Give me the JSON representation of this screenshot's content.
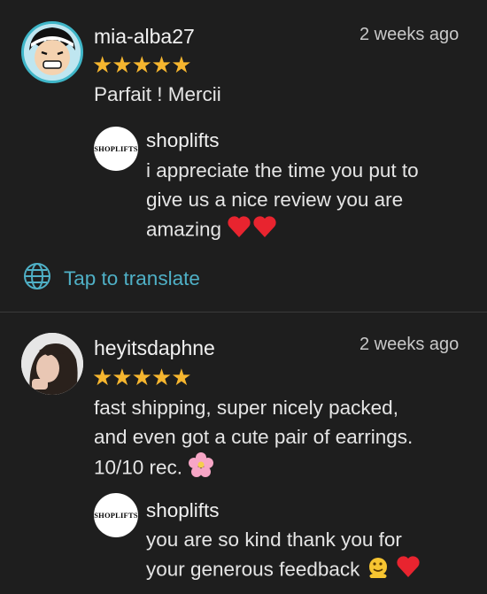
{
  "reviews": [
    {
      "username": "mia-alba27",
      "time": "2 weeks ago",
      "rating": 5,
      "stars": "★★★★★",
      "text": "Parfait ! Mercii",
      "reply": {
        "avatar_text": "SHOPLIFTS",
        "name": "shoplifts",
        "lines": [
          "i appreciate the time you put to",
          "give us a nice review you are",
          "amazing"
        ]
      },
      "translate_label": "Tap to translate"
    },
    {
      "username": "heyitsdaphne",
      "time": "2 weeks ago",
      "rating": 5,
      "stars": "★★★★★",
      "lines": [
        "fast shipping, super nicely packed,",
        "and even got a cute pair of earrings.",
        "10/10 rec."
      ],
      "reply": {
        "avatar_text": "SHOPLIFTS",
        "name": "shoplifts",
        "lines": [
          "you are so kind thank you for",
          "your generous feedback"
        ]
      }
    }
  ],
  "colors": {
    "background": "#1e1e1e",
    "star": "#f6b62f",
    "link": "#4fb0c6",
    "divider": "#3a3a3a"
  },
  "icons": [
    "globe-icon",
    "heart-emoji",
    "blossom-emoji",
    "melting-face-emoji"
  ]
}
